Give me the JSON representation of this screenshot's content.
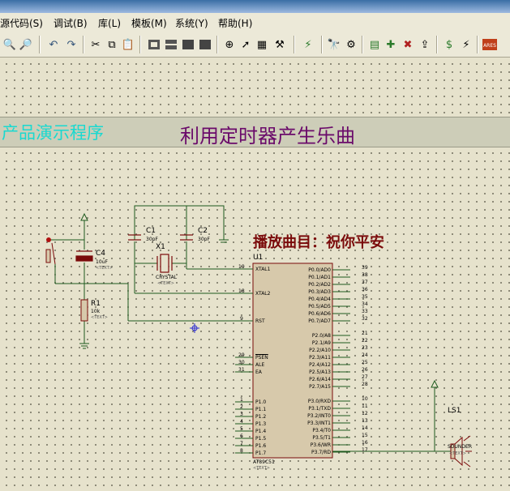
{
  "menu": [
    "源代码(S)",
    "调试(B)",
    "库(L)",
    "模板(M)",
    "系统(Y)",
    "帮助(H)"
  ],
  "toolbar": {
    "icons": [
      "zoom-in-icon",
      "zoom-out-icon",
      "undo-icon",
      "redo-icon",
      "cut-icon",
      "copy-icon",
      "paste-icon",
      "block-copy-icon",
      "block-move-icon",
      "block-rotate-icon",
      "block-delete-icon",
      "pick-device-icon",
      "make-device-icon",
      "packaging-tool-icon",
      "decompose-icon",
      "wire-autorouter-icon",
      "search-tag-icon",
      "property-assign-icon",
      "new-sheet-icon",
      "remove-sheet-icon",
      "goto-sheet-icon",
      "bill-of-materials-icon",
      "electrical-rules-icon",
      "netlist-to-ares-icon"
    ]
  },
  "banner": {
    "left_title": "产品演示程序",
    "center_title": "利用定时器产生乐曲"
  },
  "song_label": "播放曲目：祝你平安",
  "text_tag": "<TEXT>",
  "components": {
    "c1": {
      "ref": "C1",
      "value": "30pF"
    },
    "c2": {
      "ref": "C2",
      "value": "30pF"
    },
    "x1": {
      "ref": "X1",
      "value": "CRYSTAL"
    },
    "c4": {
      "ref": "C4",
      "value": "10uF"
    },
    "r1": {
      "ref": "R1",
      "value": "10k"
    },
    "u1": {
      "ref": "U1",
      "value": "AT89C51"
    },
    "ls1": {
      "ref": "LS1",
      "value": "SOUNDER"
    }
  },
  "u1_left_pins": [
    {
      "num": "19",
      "name": "XTAL1"
    },
    {
      "num": "18",
      "name": "XTAL2"
    },
    {
      "num": "9",
      "name": "RST"
    },
    {
      "num": "29",
      "name": "PSEN"
    },
    {
      "num": "30",
      "name": "ALE"
    },
    {
      "num": "31",
      "name": "EA"
    },
    {
      "num": "1",
      "name": "P1.0"
    },
    {
      "num": "2",
      "name": "P1.1"
    },
    {
      "num": "3",
      "name": "P1.2"
    },
    {
      "num": "4",
      "name": "P1.3"
    },
    {
      "num": "5",
      "name": "P1.4"
    },
    {
      "num": "6",
      "name": "P1.5"
    },
    {
      "num": "7",
      "name": "P1.6"
    },
    {
      "num": "8",
      "name": "P1.7"
    }
  ],
  "u1_right_pins": [
    {
      "num": "39",
      "name": "P0.0/AD0"
    },
    {
      "num": "38",
      "name": "P0.1/AD1"
    },
    {
      "num": "37",
      "name": "P0.2/AD2"
    },
    {
      "num": "36",
      "name": "P0.3/AD3"
    },
    {
      "num": "35",
      "name": "P0.4/AD4"
    },
    {
      "num": "34",
      "name": "P0.5/AD5"
    },
    {
      "num": "33",
      "name": "P0.6/AD6"
    },
    {
      "num": "32",
      "name": "P0.7/AD7"
    },
    {
      "num": "21",
      "name": "P2.0/A8"
    },
    {
      "num": "22",
      "name": "P2.1/A9"
    },
    {
      "num": "23",
      "name": "P2.2/A10"
    },
    {
      "num": "24",
      "name": "P2.3/A11"
    },
    {
      "num": "25",
      "name": "P2.4/A12"
    },
    {
      "num": "26",
      "name": "P2.5/A13"
    },
    {
      "num": "27",
      "name": "P2.6/A14"
    },
    {
      "num": "28",
      "name": "P2.7/A15"
    },
    {
      "num": "10",
      "name": "P3.0/RXD"
    },
    {
      "num": "11",
      "name": "P3.1/TXD"
    },
    {
      "num": "12",
      "name": "P3.2/INT0"
    },
    {
      "num": "13",
      "name": "P3.3/INT1"
    },
    {
      "num": "14",
      "name": "P3.4/T0"
    },
    {
      "num": "15",
      "name": "P3.5/T1"
    },
    {
      "num": "16",
      "name": "P3.6/WR"
    },
    {
      "num": "17",
      "name": "P3.7/RD"
    }
  ],
  "colors": {
    "wire": "#1e5a1e",
    "component": "#7a0a0a",
    "chip_fill": "#d7c9ab",
    "banner_left": "#19d9d0",
    "banner_center": "#6a0a6a"
  }
}
